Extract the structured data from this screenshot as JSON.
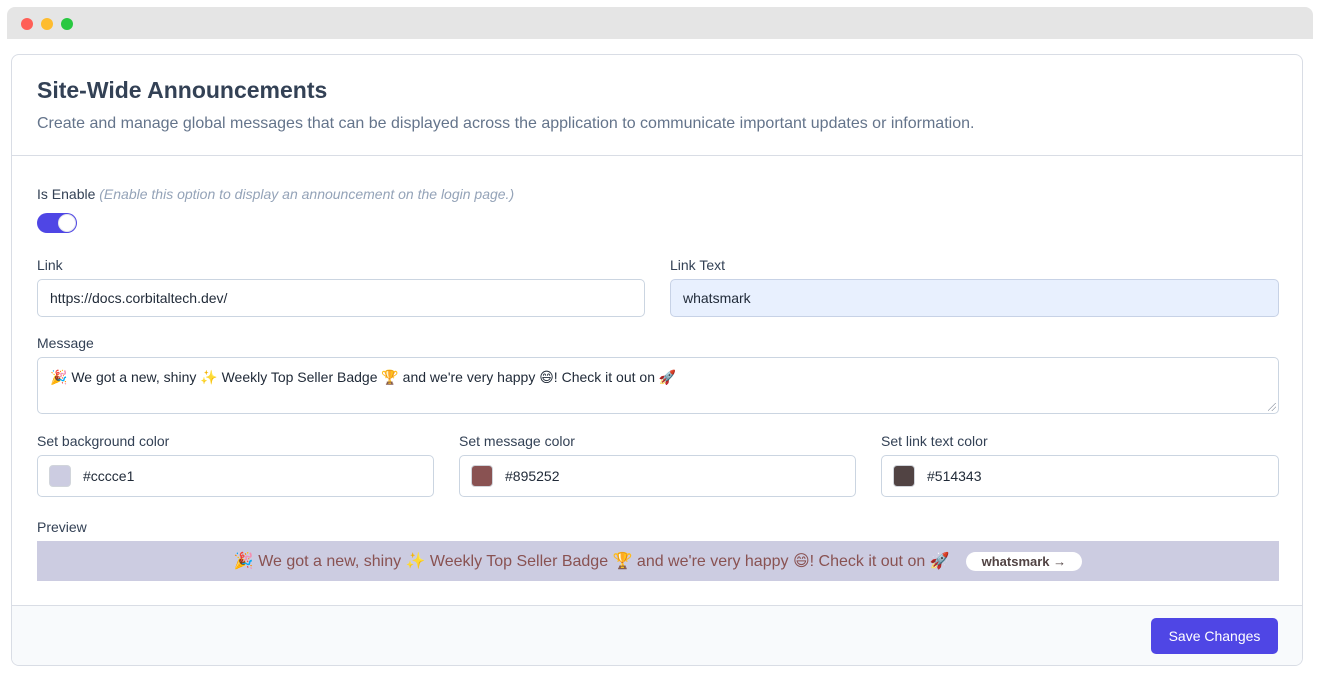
{
  "header": {
    "title": "Site-Wide Announcements",
    "subtitle": "Create and manage global messages that can be displayed across the application to communicate important updates or information."
  },
  "enable": {
    "label": "Is Enable",
    "hint": "(Enable this option to display an announcement on the login page.)",
    "checked": true
  },
  "link": {
    "label": "Link",
    "value": "https://docs.corbitaltech.dev/"
  },
  "link_text": {
    "label": "Link Text",
    "value": "whatsmark"
  },
  "message": {
    "label": "Message",
    "value": "🎉 We got a new, shiny ✨ Weekly Top Seller Badge 🏆 and we're very happy 😄! Check it out on 🚀"
  },
  "colors": {
    "background": {
      "label": "Set background color",
      "value": "#cccce1"
    },
    "message": {
      "label": "Set message color",
      "value": "#895252"
    },
    "link_text": {
      "label": "Set link text color",
      "value": "#514343"
    }
  },
  "preview": {
    "label": "Preview",
    "link_label": "whatsmark →"
  },
  "footer": {
    "save_label": "Save Changes"
  },
  "theme": {
    "accent": "#4f46e5"
  }
}
